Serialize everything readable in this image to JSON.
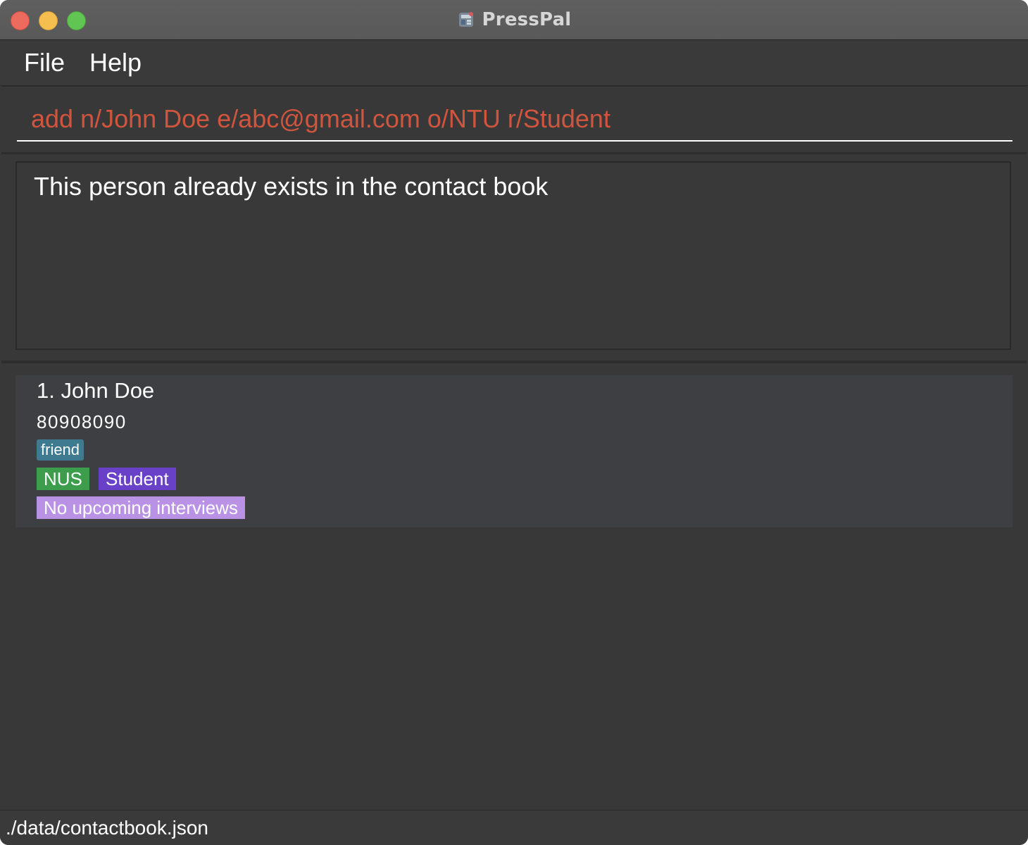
{
  "window": {
    "title": "PressPal",
    "app_icon": "presspal-app-icon"
  },
  "menu": {
    "items": [
      {
        "label": "File"
      },
      {
        "label": "Help"
      }
    ]
  },
  "command_box": {
    "value": "add n/John Doe e/abc@gmail.com o/NTU r/Student",
    "text_color": "#d0553f"
  },
  "result_display": {
    "message": "This person already exists in the contact book"
  },
  "person_list": {
    "items": [
      {
        "index_name": "1. John Doe",
        "phone": "80908090",
        "tags": [
          "friend"
        ],
        "organisation": "NUS",
        "role": "Student",
        "interview_status": "No upcoming interviews"
      }
    ]
  },
  "status_bar": {
    "path": "./data/contactbook.json"
  },
  "colors": {
    "background": "#383838",
    "tag_friend": "#3e7b91",
    "badge_org": "#3c9d4c",
    "badge_role": "#6940c8",
    "badge_interview": "#b992e6",
    "traffic_close": "#ed6a5e",
    "traffic_min": "#f5bf4f",
    "traffic_max": "#61c554"
  }
}
